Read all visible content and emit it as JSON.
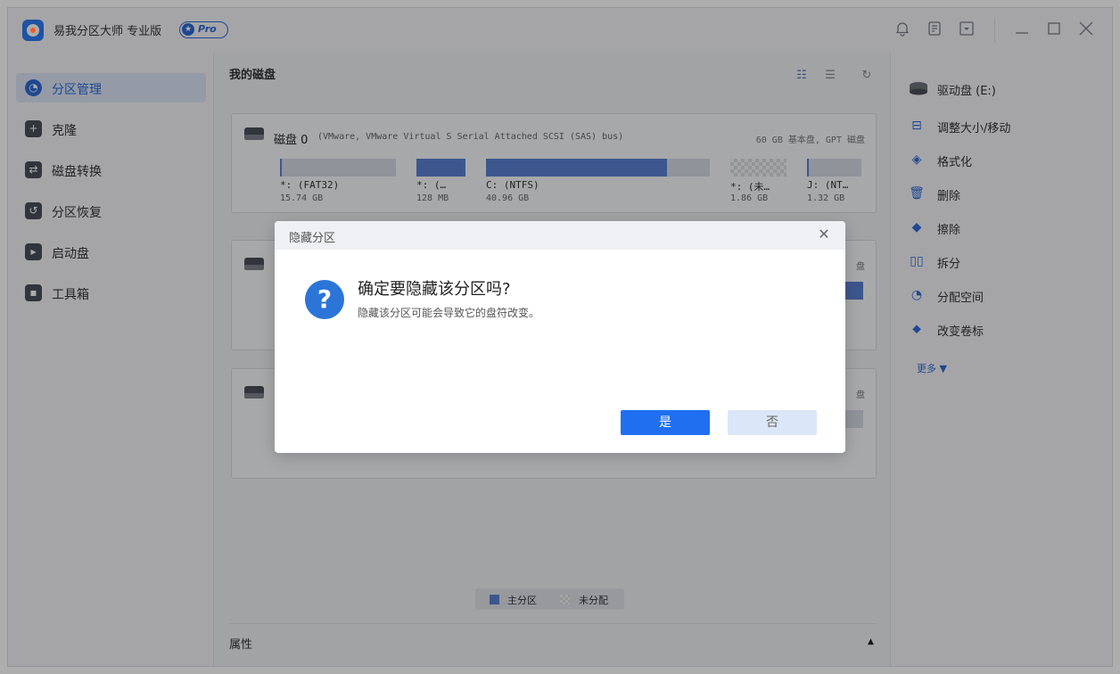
{
  "app": {
    "title": "易我分区大师 专业版",
    "badge": "Pro"
  },
  "titlebar_icons": [
    "bell-icon",
    "note-icon",
    "dropdown-box-icon",
    "minimize-icon",
    "maximize-icon",
    "close-icon"
  ],
  "sidebar": {
    "items": [
      {
        "label": "分区管理",
        "icon": "pie-chart-icon",
        "active": true
      },
      {
        "label": "克隆",
        "icon": "clone-icon",
        "active": false
      },
      {
        "label": "磁盘转换",
        "icon": "convert-icon",
        "active": false
      },
      {
        "label": "分区恢复",
        "icon": "recover-icon",
        "active": false
      },
      {
        "label": "启动盘",
        "icon": "boot-disk-icon",
        "active": false
      },
      {
        "label": "工具箱",
        "icon": "toolbox-icon",
        "active": false
      }
    ]
  },
  "main": {
    "title": "我的磁盘",
    "disks": [
      {
        "name": "磁盘 0",
        "description": "(VMware, VMware Virtual S Serial Attached SCSI (SAS) bus)",
        "meta": "60 GB 基本盘, GPT 磁盘",
        "partitions": [
          {
            "label": "*: (FAT32)",
            "size": "15.74 GB",
            "used_fraction": 0.02,
            "type": "primary"
          },
          {
            "label": "*: (…",
            "size": "128 MB",
            "used_fraction": 1.0,
            "type": "primary"
          },
          {
            "label": "C: (NTFS)",
            "size": "40.96 GB",
            "used_fraction": 0.81,
            "type": "primary"
          },
          {
            "label": "*: (未…",
            "size": "1.86 GB",
            "used_fraction": 0,
            "type": "unallocated"
          },
          {
            "label": "J: (NT…",
            "size": "1.32 GB",
            "used_fraction": 0.03,
            "type": "primary"
          }
        ]
      },
      {
        "meta_partial": "盘"
      },
      {
        "meta_partial": "盘"
      }
    ],
    "legend": {
      "primary": "主分区",
      "unallocated": "未分配"
    },
    "properties_label": "属性"
  },
  "right_panel": {
    "drive": "驱动盘 (E:)",
    "actions": [
      {
        "label": "调整大小/移动",
        "icon": "resize-icon"
      },
      {
        "label": "格式化",
        "icon": "format-icon"
      },
      {
        "label": "删除",
        "icon": "trash-icon"
      },
      {
        "label": "擦除",
        "icon": "eraser-icon"
      },
      {
        "label": "拆分",
        "icon": "split-icon"
      },
      {
        "label": "分配空间",
        "icon": "allocate-icon"
      },
      {
        "label": "改变卷标",
        "icon": "tag-icon"
      }
    ],
    "more": "更多 ▼"
  },
  "dialog": {
    "title": "隐藏分区",
    "question": "确定要隐藏该分区吗?",
    "message": "隐藏该分区可能会导致它的盘符改变。",
    "yes": "是",
    "no": "否"
  },
  "colors": {
    "accent": "#1f6ff0",
    "partition_fill": "#5b80d1",
    "overlay": "rgba(0,0,0,0.32)"
  }
}
